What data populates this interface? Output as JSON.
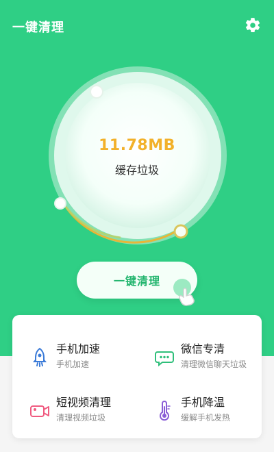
{
  "header": {
    "title": "一键清理",
    "settings_icon": "gear-icon"
  },
  "cleaner": {
    "size": "11.78MB",
    "label": "缓存垃圾"
  },
  "primary_button": {
    "label": "一键清理"
  },
  "features": [
    {
      "title": "手机加速",
      "subtitle": "手机加速",
      "icon": "rocket-icon",
      "color": "#3b7bd8"
    },
    {
      "title": "微信专清",
      "subtitle": "清理微信聊天垃圾",
      "icon": "chat-icon",
      "color": "#2fbf7a"
    },
    {
      "title": "短视频清理",
      "subtitle": "清理视频垃圾",
      "icon": "video-icon",
      "color": "#f05b80"
    },
    {
      "title": "手机降温",
      "subtitle": "缓解手机发热",
      "icon": "thermometer-icon",
      "color": "#8a5cd6"
    }
  ],
  "colors": {
    "primary": "#2fcf85",
    "accent": "#f2b12a"
  }
}
